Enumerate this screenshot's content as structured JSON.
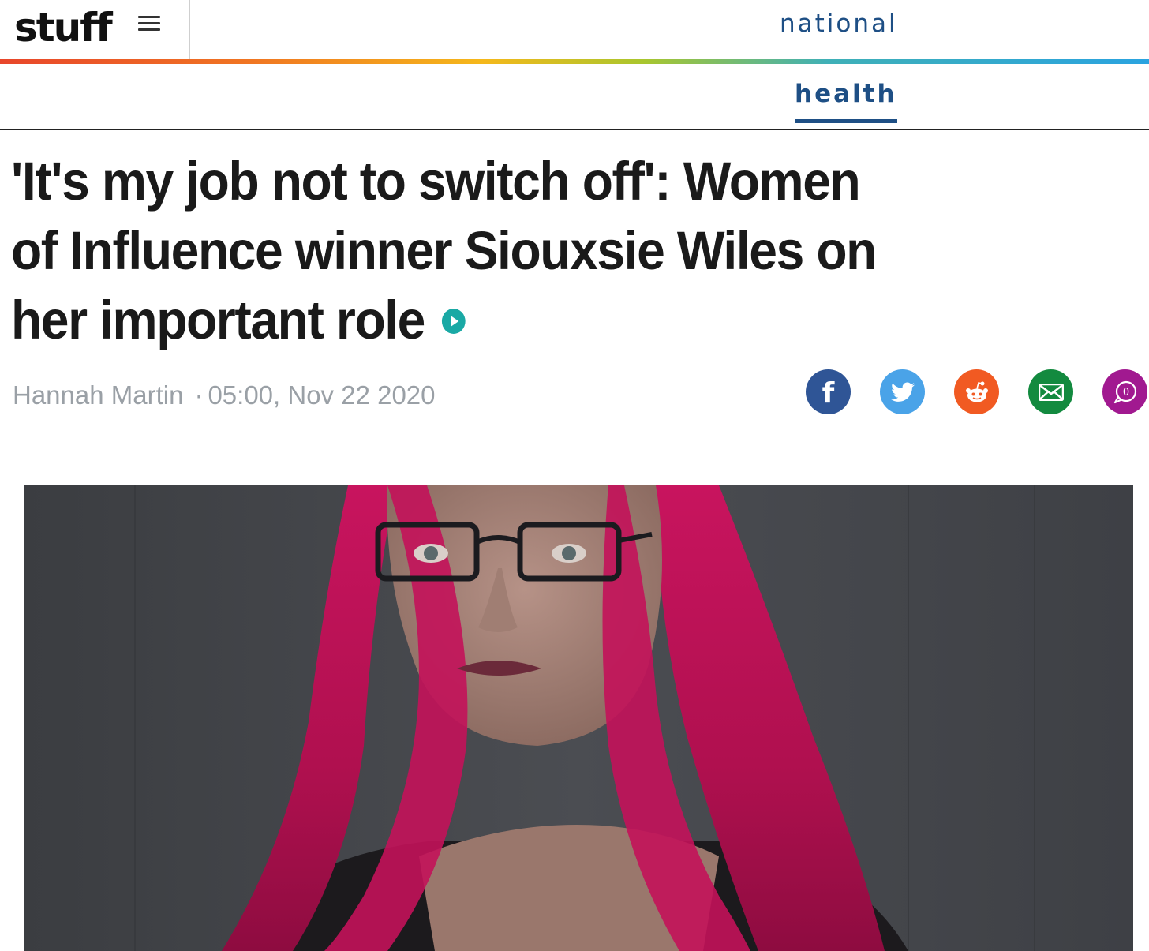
{
  "header": {
    "logo": "stuff",
    "section": "national"
  },
  "subnav": {
    "active_tab": "health"
  },
  "article": {
    "headline": "'It's my job not to switch off': Women of Influence winner Siouxsie Wiles on her important role",
    "author": "Hannah Martin",
    "separator": "·",
    "timestamp": "05:00, Nov 22 2020",
    "comment_count": "0"
  },
  "share": {
    "icons": [
      "facebook-icon",
      "twitter-icon",
      "reddit-icon",
      "email-icon",
      "comment-icon"
    ]
  },
  "colors": {
    "brand_blue": "#1e4f85",
    "video_teal": "#1aa9a5",
    "facebook": "#2f5596",
    "twitter": "#4aa3e8",
    "reddit": "#f15a22",
    "email": "#138a3f",
    "comments": "#a11990"
  }
}
